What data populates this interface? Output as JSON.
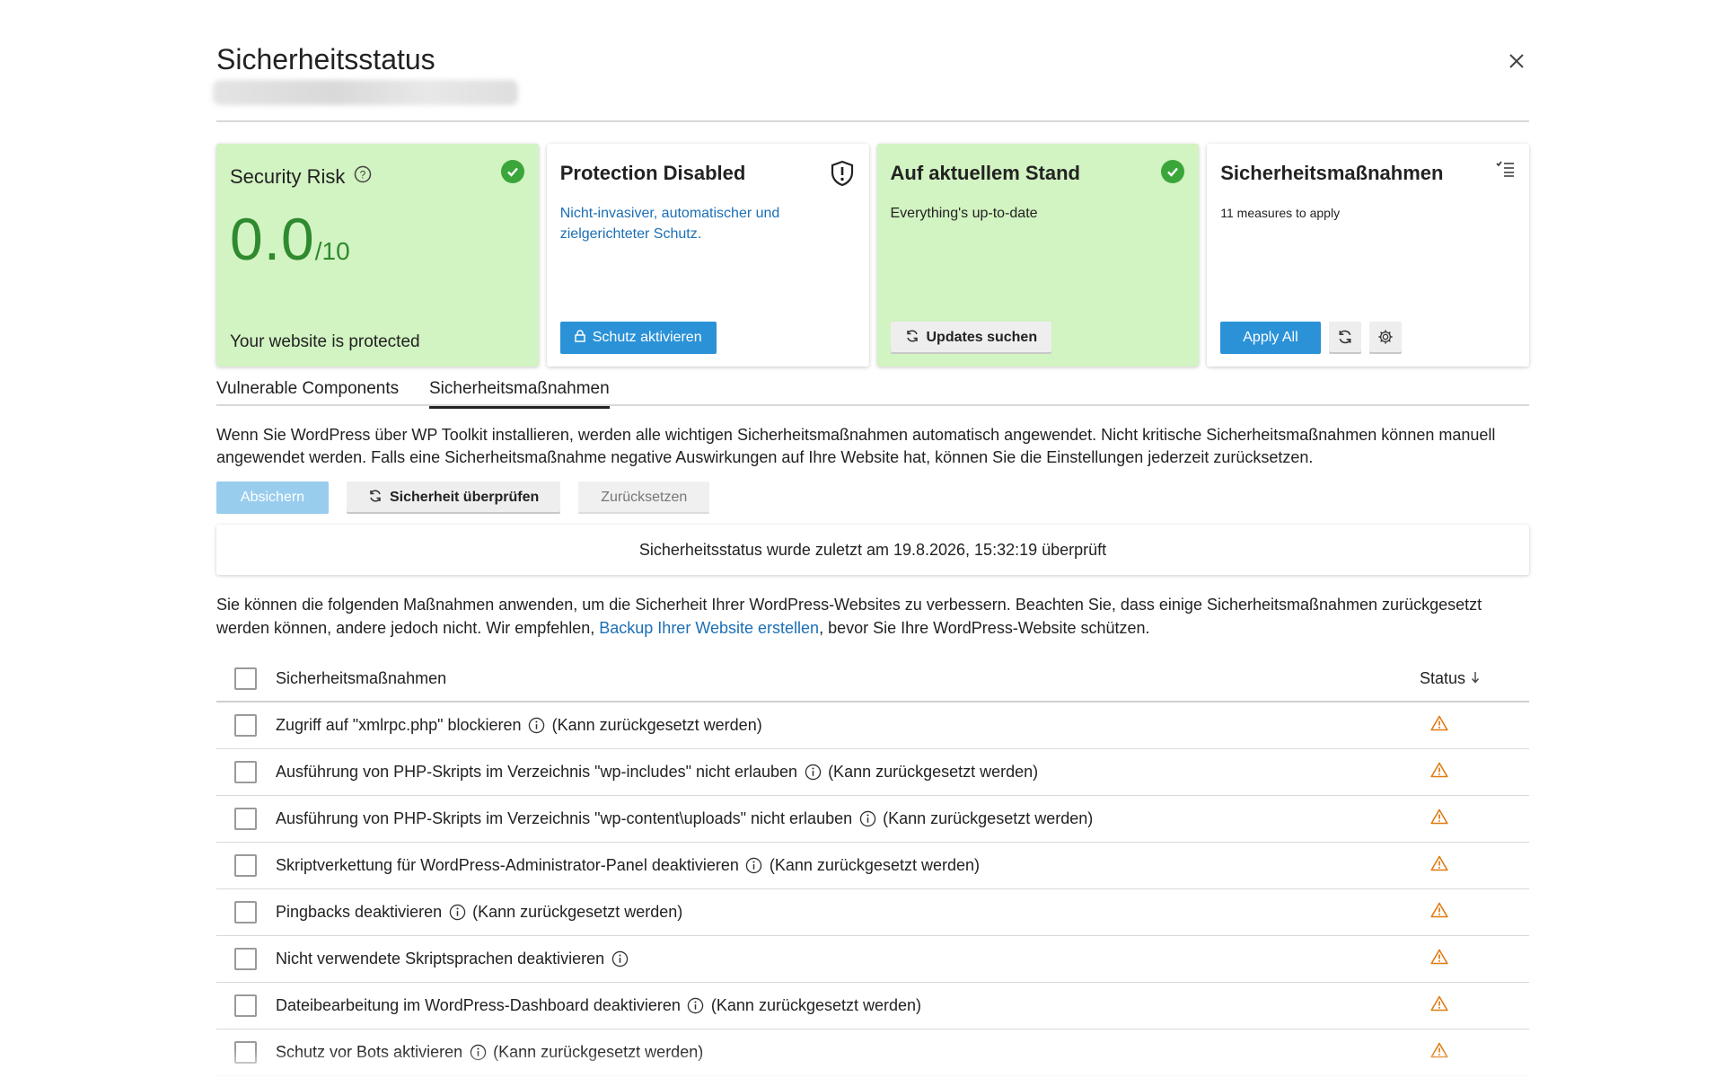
{
  "dialog": {
    "title": "Sicherheitsstatus",
    "close_icon": "close-icon"
  },
  "cards": {
    "risk": {
      "title": "Security Risk",
      "score": "0.0",
      "score_max": "/10",
      "footer": "Your website is protected",
      "icons": [
        "help-icon",
        "check-circle-icon"
      ]
    },
    "protection": {
      "title": "Protection Disabled",
      "description": "Nicht-invasiver, automatischer und zielgerichteter Schutz.",
      "button_label": "Schutz aktivieren",
      "icons": [
        "shield-alert-icon",
        "lock-icon"
      ]
    },
    "updates": {
      "title": "Auf aktuellem Stand",
      "description": "Everything's up-to-date",
      "button_label": "Updates suchen",
      "icons": [
        "check-circle-icon",
        "refresh-icon"
      ]
    },
    "measures": {
      "title": "Sicherheitsmaßnahmen",
      "description": "11 measures to apply",
      "button_label": "Apply All",
      "icons": [
        "checklist-icon",
        "refresh-icon",
        "gear-icon"
      ]
    }
  },
  "tabs": [
    {
      "label": "Vulnerable Components",
      "active": false
    },
    {
      "label": "Sicherheitsmaßnahmen",
      "active": true
    }
  ],
  "intro": "Wenn Sie WordPress über WP Toolkit installieren, werden alle wichtigen Sicherheitsmaßnahmen automatisch angewendet. Nicht kritische Sicherheitsmaßnahmen können manuell angewendet werden. Falls eine Sicherheitsmaßnahme negative Auswirkungen auf Ihre Website hat, können Sie die Einstellungen jederzeit zurücksetzen.",
  "actions": {
    "secure_label": "Absichern",
    "check_label": "Sicherheit überprüfen",
    "reset_label": "Zurücksetzen"
  },
  "last_checked": "Sicherheitsstatus wurde zuletzt am 19.8.2026, 15:32:19 überprüft",
  "intro2": {
    "before": "Sie können die folgenden Maßnahmen anwenden, um die Sicherheit Ihrer WordPress-Websites zu verbessern. Beachten Sie, dass einige Sicherheitsmaßnahmen zurückgesetzt werden können, andere jedoch nicht. Wir empfehlen, ",
    "link": "Backup Ihrer Website erstellen",
    "after": ", bevor Sie Ihre WordPress-Website schützen."
  },
  "table": {
    "col_name": "Sicherheitsmaßnahmen",
    "col_status": "Status",
    "sort_icon": "arrow-down-icon",
    "status_icon": "warning-icon",
    "status_color": "#e07b12",
    "rows": [
      {
        "name": "Zugriff auf \"xmlrpc.php\" blockieren",
        "note": "(Kann zurückgesetzt werden)"
      },
      {
        "name": "Ausführung von PHP-Skripts im Verzeichnis \"wp-includes\" nicht erlauben",
        "note": "(Kann zurückgesetzt werden)"
      },
      {
        "name": "Ausführung von PHP-Skripts im Verzeichnis \"wp-content\\uploads\" nicht erlauben",
        "note": "(Kann zurückgesetzt werden)"
      },
      {
        "name": "Skriptverkettung für WordPress-Administrator-Panel deaktivieren",
        "note": "(Kann zurückgesetzt werden)"
      },
      {
        "name": "Pingbacks deaktivieren",
        "note": "(Kann zurückgesetzt werden)"
      },
      {
        "name": "Nicht verwendete Skriptsprachen deaktivieren",
        "note": ""
      },
      {
        "name": "Dateibearbeitung im WordPress-Dashboard deaktivieren",
        "note": "(Kann zurückgesetzt werden)"
      },
      {
        "name": "Schutz vor Bots aktivieren",
        "note": "(Kann zurückgesetzt werden)"
      }
    ]
  },
  "colors": {
    "green_card": "#d2f3c2",
    "accent": "#2b92d8",
    "link": "#1b6fb5",
    "score": "#2f8a2f"
  }
}
